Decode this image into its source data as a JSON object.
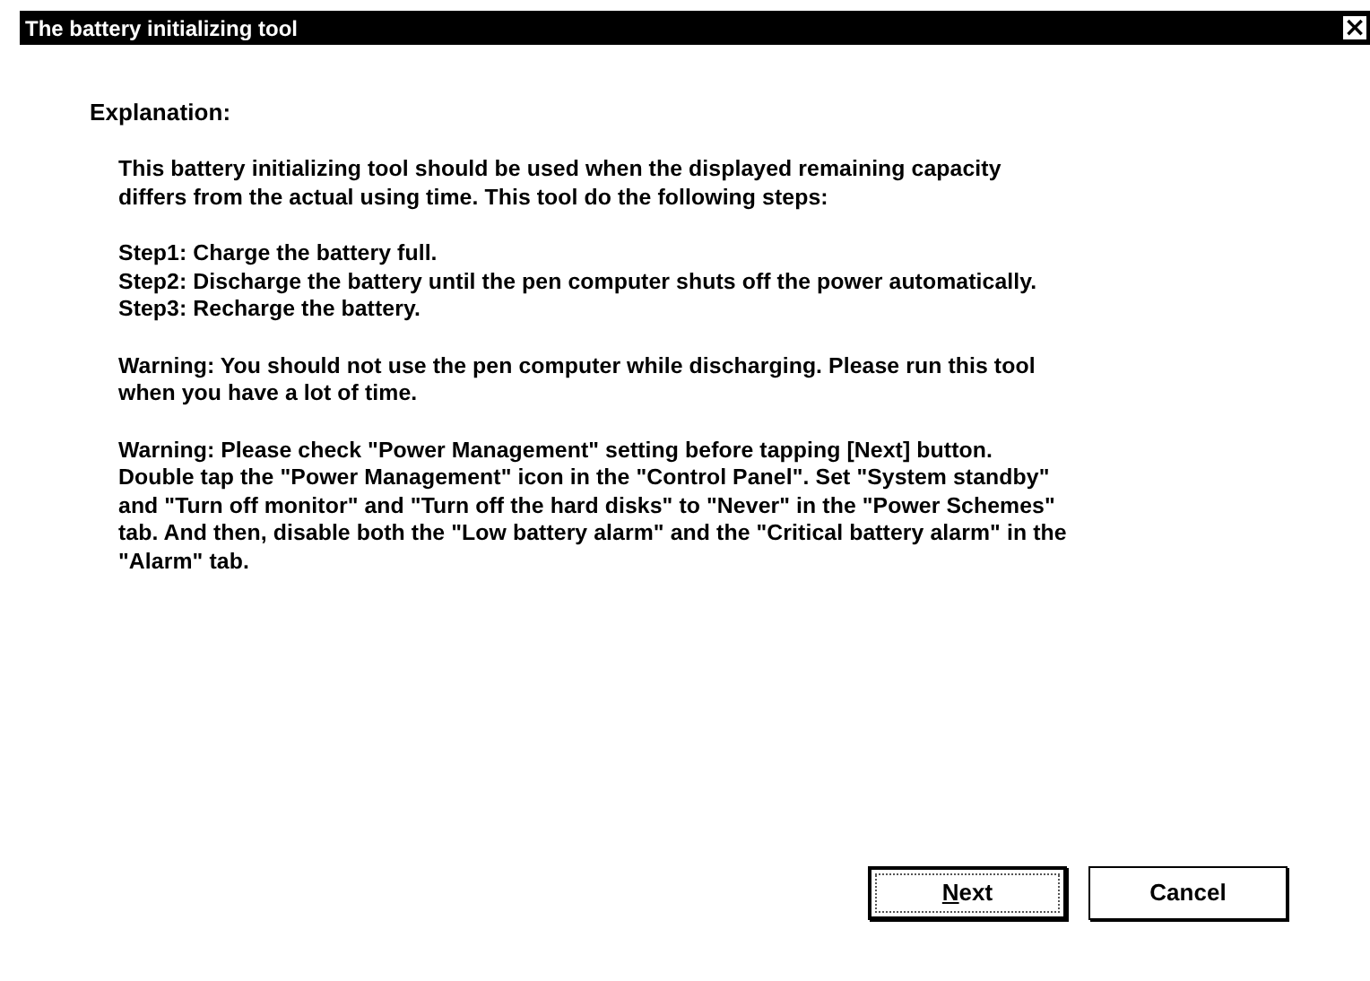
{
  "window": {
    "title": "The battery initializing tool",
    "close_glyph": "×"
  },
  "heading": "Explanation:",
  "paragraphs": [
    "This battery initializing tool should be used when the displayed remaining capacity\ndiffers from the actual using time. This tool do the following steps:",
    "Step1: Charge the battery full.\nStep2: Discharge the battery until the pen computer shuts off the power automatically.\nStep3: Recharge the battery.",
    "Warning: You should not use the pen computer while discharging. Please run this tool\nwhen you have a lot of time.",
    "Warning: Please check \"Power Management\" setting before tapping [Next] button.\nDouble tap the \"Power Management\" icon in the \"Control Panel\". Set \"System standby\"\nand \"Turn off monitor\" and \"Turn off the hard disks\" to \"Never\" in the \"Power Schemes\"\ntab. And then, disable both the \"Low battery alarm\" and the \"Critical battery alarm\" in the\n\"Alarm\" tab."
  ],
  "buttons": [
    {
      "label": "Next",
      "default": true,
      "focused": true,
      "underline_first": true
    },
    {
      "label": "Cancel",
      "default": false,
      "focused": false,
      "underline_first": false
    }
  ]
}
